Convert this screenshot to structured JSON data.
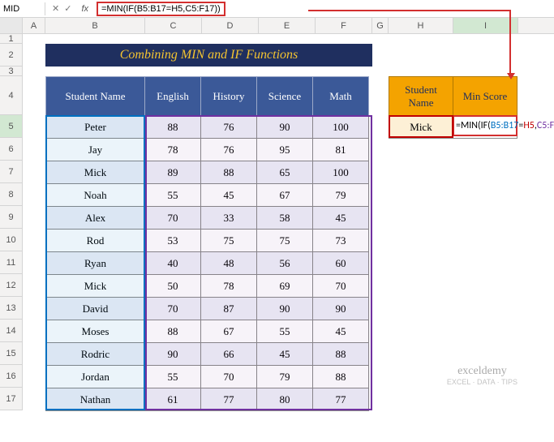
{
  "formula_bar": {
    "name_box": "MID",
    "formula": "=MIN(IF(B5:B17=H5,C5:F17))"
  },
  "columns": [
    "A",
    "B",
    "C",
    "D",
    "E",
    "F",
    "G",
    "H",
    "I"
  ],
  "rows": [
    "1",
    "2",
    "3",
    "4",
    "5",
    "6",
    "7",
    "8",
    "9",
    "10",
    "11",
    "12",
    "13",
    "14",
    "15",
    "16",
    "17"
  ],
  "title": "Combining MIN and IF Functions",
  "main_headers": [
    "Student Name",
    "English",
    "History",
    "Science",
    "Math"
  ],
  "students": [
    {
      "name": "Peter",
      "scores": [
        88,
        76,
        90,
        100
      ]
    },
    {
      "name": "Jay",
      "scores": [
        78,
        76,
        95,
        81
      ]
    },
    {
      "name": "Mick",
      "scores": [
        89,
        88,
        65,
        100
      ]
    },
    {
      "name": "Noah",
      "scores": [
        55,
        45,
        67,
        79
      ]
    },
    {
      "name": "Alex",
      "scores": [
        70,
        33,
        58,
        45
      ]
    },
    {
      "name": "Rod",
      "scores": [
        53,
        75,
        75,
        73
      ]
    },
    {
      "name": "Ryan",
      "scores": [
        40,
        48,
        56,
        60
      ]
    },
    {
      "name": "Mick",
      "scores": [
        50,
        78,
        69,
        70
      ]
    },
    {
      "name": "David",
      "scores": [
        70,
        87,
        90,
        90
      ]
    },
    {
      "name": "Moses",
      "scores": [
        88,
        67,
        55,
        45
      ]
    },
    {
      "name": "Rodric",
      "scores": [
        90,
        66,
        45,
        88
      ]
    },
    {
      "name": "Jordan",
      "scores": [
        55,
        70,
        79,
        88
      ]
    },
    {
      "name": "Nathan",
      "scores": [
        61,
        77,
        80,
        77
      ]
    }
  ],
  "lookup": {
    "h1": "Student Name",
    "h2": "Min Score",
    "value": "Mick",
    "formula_parts": {
      "p1": "=MIN(IF(",
      "p2": "B5:B17",
      "p3": "=",
      "p4": "H5",
      "p5": ",",
      "p6": "C5:F17",
      "p7": "))"
    }
  },
  "watermark": {
    "line1": "exceldemy",
    "line2": "EXCEL · DATA · TIPS"
  },
  "chart_data": {
    "type": "table",
    "title": "Combining MIN and IF Functions",
    "columns": [
      "Student Name",
      "English",
      "History",
      "Science",
      "Math"
    ],
    "rows": [
      [
        "Peter",
        88,
        76,
        90,
        100
      ],
      [
        "Jay",
        78,
        76,
        95,
        81
      ],
      [
        "Mick",
        89,
        88,
        65,
        100
      ],
      [
        "Noah",
        55,
        45,
        67,
        79
      ],
      [
        "Alex",
        70,
        33,
        58,
        45
      ],
      [
        "Rod",
        53,
        75,
        75,
        73
      ],
      [
        "Ryan",
        40,
        48,
        56,
        60
      ],
      [
        "Mick",
        50,
        78,
        69,
        70
      ],
      [
        "David",
        70,
        87,
        90,
        90
      ],
      [
        "Moses",
        88,
        67,
        55,
        45
      ],
      [
        "Rodric",
        90,
        66,
        45,
        88
      ],
      [
        "Jordan",
        55,
        70,
        79,
        88
      ],
      [
        "Nathan",
        61,
        77,
        80,
        77
      ]
    ],
    "lookup": {
      "Student Name": "Mick",
      "formula": "=MIN(IF(B5:B17=H5,C5:F17))"
    }
  }
}
